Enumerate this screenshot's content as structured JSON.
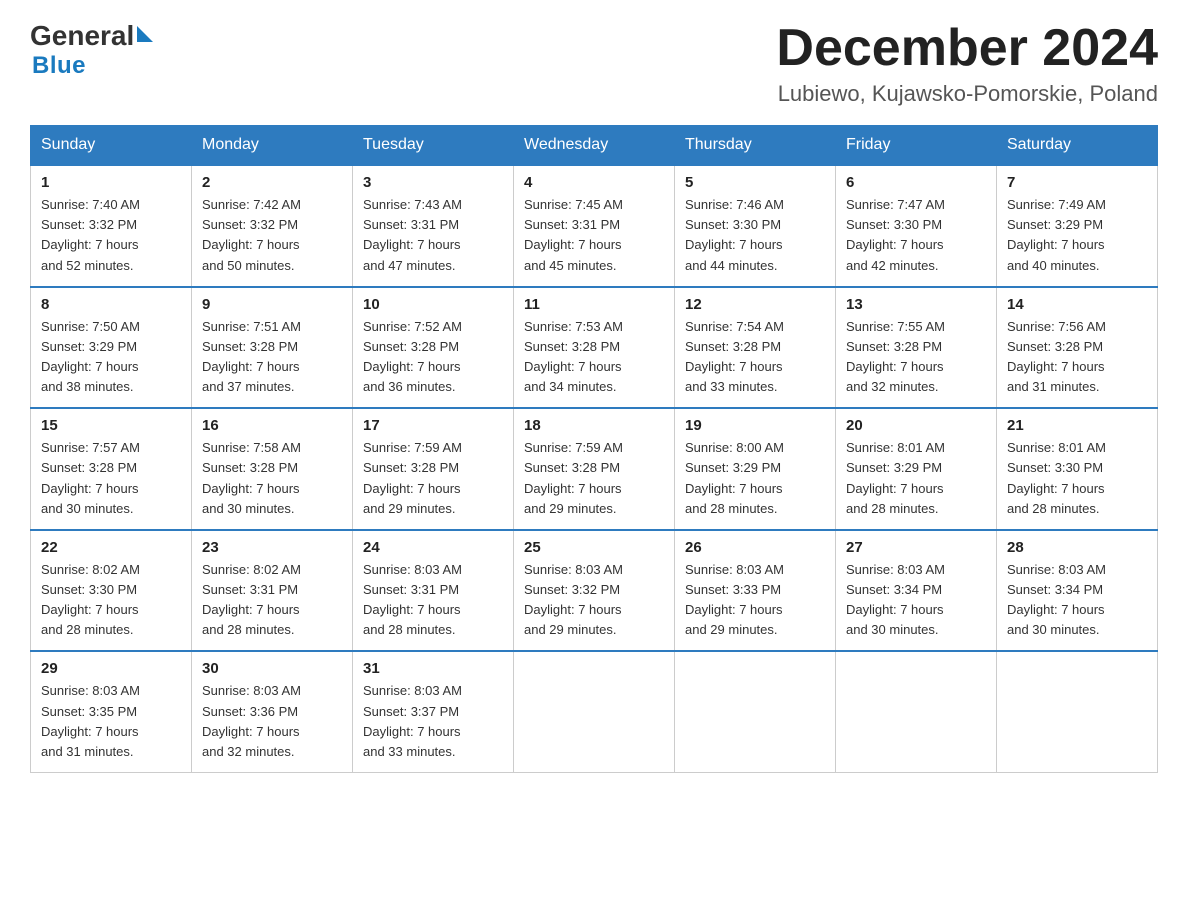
{
  "logo": {
    "general": "General",
    "blue": "Blue",
    "triangle_color": "#1a7abf"
  },
  "header": {
    "month_title": "December 2024",
    "location": "Lubiewo, Kujawsko-Pomorskie, Poland"
  },
  "days_of_week": [
    "Sunday",
    "Monday",
    "Tuesday",
    "Wednesday",
    "Thursday",
    "Friday",
    "Saturday"
  ],
  "weeks": [
    [
      {
        "day": "1",
        "sunrise": "7:40 AM",
        "sunset": "3:32 PM",
        "daylight": "7 hours and 52 minutes."
      },
      {
        "day": "2",
        "sunrise": "7:42 AM",
        "sunset": "3:32 PM",
        "daylight": "7 hours and 50 minutes."
      },
      {
        "day": "3",
        "sunrise": "7:43 AM",
        "sunset": "3:31 PM",
        "daylight": "7 hours and 47 minutes."
      },
      {
        "day": "4",
        "sunrise": "7:45 AM",
        "sunset": "3:31 PM",
        "daylight": "7 hours and 45 minutes."
      },
      {
        "day": "5",
        "sunrise": "7:46 AM",
        "sunset": "3:30 PM",
        "daylight": "7 hours and 44 minutes."
      },
      {
        "day": "6",
        "sunrise": "7:47 AM",
        "sunset": "3:30 PM",
        "daylight": "7 hours and 42 minutes."
      },
      {
        "day": "7",
        "sunrise": "7:49 AM",
        "sunset": "3:29 PM",
        "daylight": "7 hours and 40 minutes."
      }
    ],
    [
      {
        "day": "8",
        "sunrise": "7:50 AM",
        "sunset": "3:29 PM",
        "daylight": "7 hours and 38 minutes."
      },
      {
        "day": "9",
        "sunrise": "7:51 AM",
        "sunset": "3:28 PM",
        "daylight": "7 hours and 37 minutes."
      },
      {
        "day": "10",
        "sunrise": "7:52 AM",
        "sunset": "3:28 PM",
        "daylight": "7 hours and 36 minutes."
      },
      {
        "day": "11",
        "sunrise": "7:53 AM",
        "sunset": "3:28 PM",
        "daylight": "7 hours and 34 minutes."
      },
      {
        "day": "12",
        "sunrise": "7:54 AM",
        "sunset": "3:28 PM",
        "daylight": "7 hours and 33 minutes."
      },
      {
        "day": "13",
        "sunrise": "7:55 AM",
        "sunset": "3:28 PM",
        "daylight": "7 hours and 32 minutes."
      },
      {
        "day": "14",
        "sunrise": "7:56 AM",
        "sunset": "3:28 PM",
        "daylight": "7 hours and 31 minutes."
      }
    ],
    [
      {
        "day": "15",
        "sunrise": "7:57 AM",
        "sunset": "3:28 PM",
        "daylight": "7 hours and 30 minutes."
      },
      {
        "day": "16",
        "sunrise": "7:58 AM",
        "sunset": "3:28 PM",
        "daylight": "7 hours and 30 minutes."
      },
      {
        "day": "17",
        "sunrise": "7:59 AM",
        "sunset": "3:28 PM",
        "daylight": "7 hours and 29 minutes."
      },
      {
        "day": "18",
        "sunrise": "7:59 AM",
        "sunset": "3:28 PM",
        "daylight": "7 hours and 29 minutes."
      },
      {
        "day": "19",
        "sunrise": "8:00 AM",
        "sunset": "3:29 PM",
        "daylight": "7 hours and 28 minutes."
      },
      {
        "day": "20",
        "sunrise": "8:01 AM",
        "sunset": "3:29 PM",
        "daylight": "7 hours and 28 minutes."
      },
      {
        "day": "21",
        "sunrise": "8:01 AM",
        "sunset": "3:30 PM",
        "daylight": "7 hours and 28 minutes."
      }
    ],
    [
      {
        "day": "22",
        "sunrise": "8:02 AM",
        "sunset": "3:30 PM",
        "daylight": "7 hours and 28 minutes."
      },
      {
        "day": "23",
        "sunrise": "8:02 AM",
        "sunset": "3:31 PM",
        "daylight": "7 hours and 28 minutes."
      },
      {
        "day": "24",
        "sunrise": "8:03 AM",
        "sunset": "3:31 PM",
        "daylight": "7 hours and 28 minutes."
      },
      {
        "day": "25",
        "sunrise": "8:03 AM",
        "sunset": "3:32 PM",
        "daylight": "7 hours and 29 minutes."
      },
      {
        "day": "26",
        "sunrise": "8:03 AM",
        "sunset": "3:33 PM",
        "daylight": "7 hours and 29 minutes."
      },
      {
        "day": "27",
        "sunrise": "8:03 AM",
        "sunset": "3:34 PM",
        "daylight": "7 hours and 30 minutes."
      },
      {
        "day": "28",
        "sunrise": "8:03 AM",
        "sunset": "3:34 PM",
        "daylight": "7 hours and 30 minutes."
      }
    ],
    [
      {
        "day": "29",
        "sunrise": "8:03 AM",
        "sunset": "3:35 PM",
        "daylight": "7 hours and 31 minutes."
      },
      {
        "day": "30",
        "sunrise": "8:03 AM",
        "sunset": "3:36 PM",
        "daylight": "7 hours and 32 minutes."
      },
      {
        "day": "31",
        "sunrise": "8:03 AM",
        "sunset": "3:37 PM",
        "daylight": "7 hours and 33 minutes."
      },
      null,
      null,
      null,
      null
    ]
  ],
  "labels": {
    "sunrise": "Sunrise:",
    "sunset": "Sunset:",
    "daylight": "Daylight:"
  }
}
